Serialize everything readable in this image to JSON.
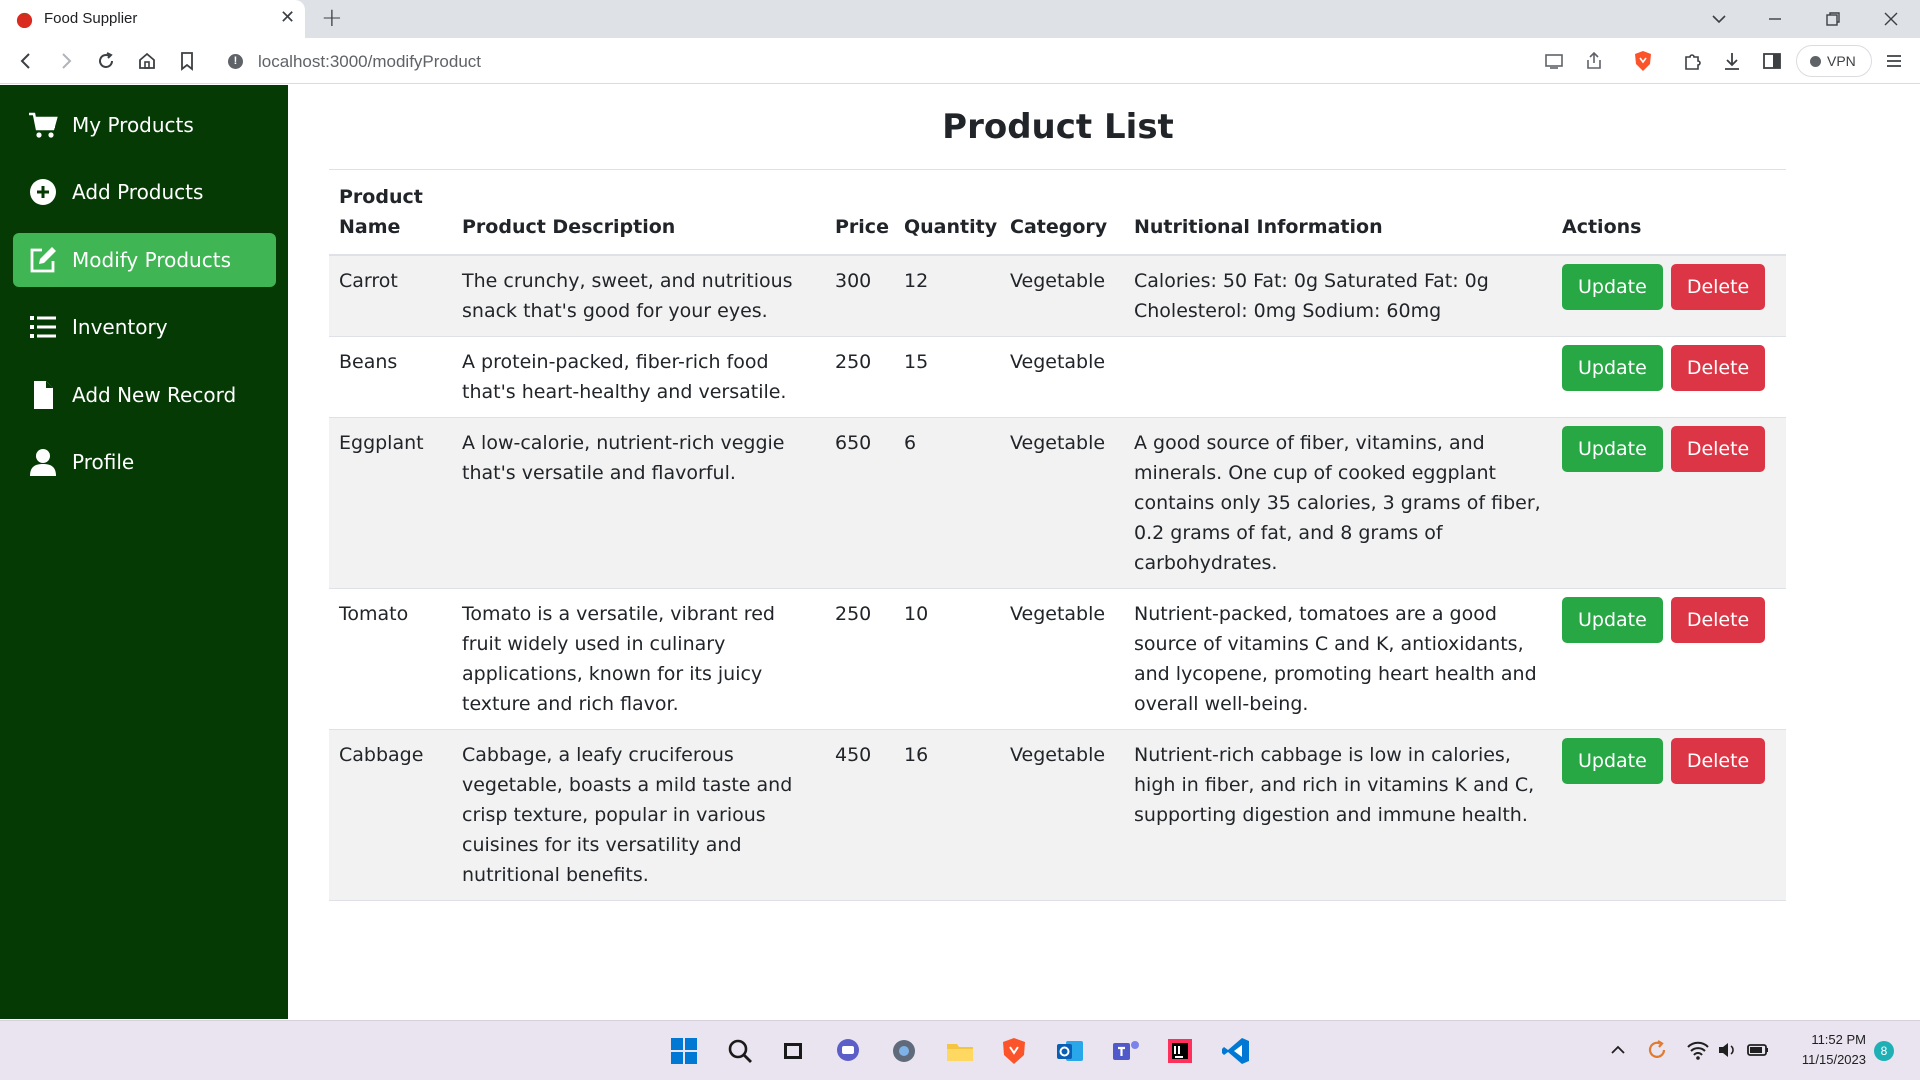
{
  "browser": {
    "tab_title": "Food Supplier",
    "url": "localhost:3000/modifyProduct",
    "vpn_label": "VPN"
  },
  "sidebar": {
    "items": [
      {
        "label": "My Products",
        "icon": "cart-icon",
        "active": false
      },
      {
        "label": "Add Products",
        "icon": "plus-circle-icon",
        "active": false
      },
      {
        "label": "Modify Products",
        "icon": "edit-icon",
        "active": true
      },
      {
        "label": "Inventory",
        "icon": "list-icon",
        "active": false
      },
      {
        "label": "Add New Record",
        "icon": "file-icon",
        "active": false
      },
      {
        "label": "Profile",
        "icon": "user-icon",
        "active": false
      }
    ],
    "bg_color": "#053a05",
    "active_color": "#3fb553"
  },
  "main": {
    "title": "Product List",
    "columns": [
      "Product Name",
      "Product Description",
      "Price",
      "Quantity",
      "Category",
      "Nutritional Information",
      "Actions"
    ],
    "update_label": "Update",
    "delete_label": "Delete",
    "rows": [
      {
        "name": "Carrot",
        "description": "The crunchy, sweet, and nutritious snack that's good for your eyes.",
        "price": "300",
        "quantity": "12",
        "category": "Vegetable",
        "nutrition": "Calories: 50 Fat: 0g Saturated Fat: 0g Cholesterol: 0mg Sodium: 60mg"
      },
      {
        "name": "Beans",
        "description": "A protein-packed, fiber-rich food that's heart-healthy and versatile.",
        "price": "250",
        "quantity": "15",
        "category": "Vegetable",
        "nutrition": ""
      },
      {
        "name": "Eggplant",
        "description": "A low-calorie, nutrient-rich veggie that's versatile and flavorful.",
        "price": "650",
        "quantity": "6",
        "category": "Vegetable",
        "nutrition": "A good source of fiber, vitamins, and minerals. One cup of cooked eggplant contains only 35 calories, 3 grams of fiber, 0.2 grams of fat, and 8 grams of carbohydrates."
      },
      {
        "name": "Tomato",
        "description": "Tomato is a versatile, vibrant red fruit widely used in culinary applications, known for its juicy texture and rich flavor.",
        "price": "250",
        "quantity": "10",
        "category": "Vegetable",
        "nutrition": "Nutrient-packed, tomatoes are a good source of vitamins C and K, antioxidants, and lycopene, promoting heart health and overall well-being."
      },
      {
        "name": "Cabbage",
        "description": "Cabbage, a leafy cruciferous vegetable, boasts a mild taste and crisp texture, popular in various cuisines for its versatility and nutritional benefits.",
        "price": "450",
        "quantity": "16",
        "category": "Vegetable",
        "nutrition": "Nutrient-rich cabbage is low in calories, high in fiber, and rich in vitamins K and C, supporting digestion and immune health."
      }
    ],
    "update_color": "#28a745",
    "delete_color": "#dc3545"
  },
  "taskbar": {
    "time": "11:52 PM",
    "date": "11/15/2023",
    "notification_count": "8"
  }
}
